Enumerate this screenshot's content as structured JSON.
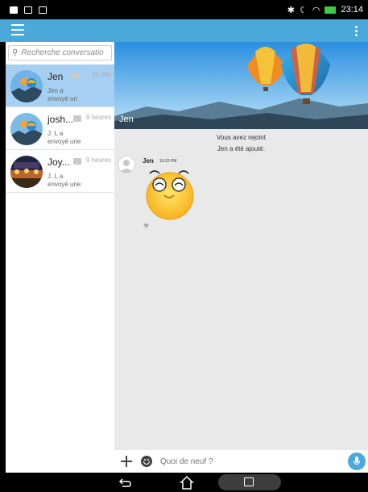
{
  "status_bar": {
    "time": "23:14"
  },
  "search": {
    "placeholder": "Recherche conversatio"
  },
  "conversations": [
    {
      "name": "Jen",
      "time": "10 min",
      "line2": "Jen a",
      "line3": "envoyé un"
    },
    {
      "name": "josh...",
      "time": "9 heures",
      "line2": "J. L a",
      "line3": "envoyé une"
    },
    {
      "name": "Joy...",
      "time": "9 heures",
      "line2": "J. L a",
      "line3": "envoyé une"
    }
  ],
  "chat": {
    "banner_title": "Jen",
    "system_messages": [
      "Vous avez rejoint",
      "Jen a été ajouté."
    ],
    "message": {
      "sender": "Jen",
      "time": "10:22 PM"
    }
  },
  "composer": {
    "placeholder": "Quoi de neuf ?"
  },
  "colors": {
    "accent": "#4aa9da",
    "selected_row": "#a6cff1",
    "chat_bg": "#e9e9e9"
  },
  "icons": {
    "menu": "hamburger-icon",
    "overflow": "more-vert-icon",
    "search": "search-icon",
    "add": "plus-icon",
    "emoji": "smiley-icon",
    "voice": "mic-icon",
    "back": "back-icon",
    "home": "home-icon",
    "recents": "recents-icon"
  }
}
